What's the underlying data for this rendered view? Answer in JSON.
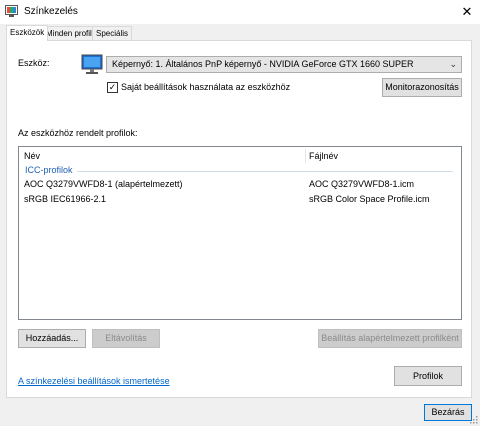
{
  "window": {
    "title": "Színkezelés",
    "close_glyph": "✕"
  },
  "tabs": [
    {
      "label": "Eszközök",
      "active": true
    },
    {
      "label": "Minden profil",
      "active": false
    },
    {
      "label": "Speciális",
      "active": false
    }
  ],
  "device": {
    "label": "Eszköz:",
    "selected": "Képernyő: 1. Általános PnP képernyő - NVIDIA GeForce GTX 1660 SUPER",
    "icon": "monitor-icon"
  },
  "use_settings": {
    "checked": true,
    "label": "Saját beállítások használata az eszközhöz"
  },
  "identify_button": "Monitorazonosítás",
  "profiles": {
    "section_label": "Az eszközhöz rendelt profilok:",
    "columns": [
      "Név",
      "Fájlnév"
    ],
    "group": "ICC-profilok",
    "rows": [
      {
        "name": "AOC Q3279VWFD8-1 (alapértelmezett)",
        "file": "AOC Q3279VWFD8-1.icm"
      },
      {
        "name": "sRGB IEC61966-2.1",
        "file": "sRGB Color Space Profile.icm"
      }
    ]
  },
  "buttons": {
    "add": "Hozzáadás...",
    "remove": "Eltávolítás",
    "set_default": "Beállítás alapértelmezett profilként",
    "profiles": "Profilok",
    "close": "Bezárás"
  },
  "link": "A színkezelési beállítások ismertetése",
  "colors": {
    "link": "#0066cc",
    "group_header": "#1e5fb4",
    "accent": "#0078d7"
  }
}
